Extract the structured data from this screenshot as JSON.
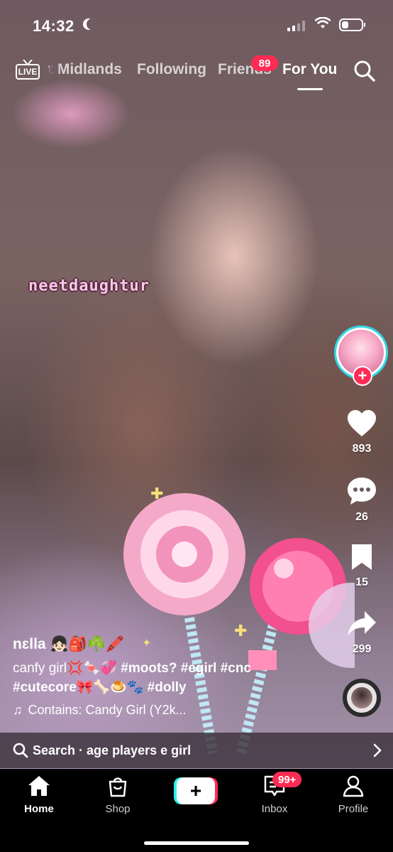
{
  "status_bar": {
    "time": "14:32",
    "battery_level": 0.35,
    "signal_bars_active": 2,
    "signal_bars_total": 4
  },
  "top_nav": {
    "live_label": "LIVE",
    "tabs": [
      {
        "label": "t Midlands"
      },
      {
        "label": "Following"
      },
      {
        "label": "Friends"
      },
      {
        "label": "For You"
      }
    ],
    "active_tab": "For You",
    "friends_badge": "89"
  },
  "video": {
    "overlay_text": "neetdaughtur"
  },
  "actions": {
    "likes": "893",
    "comments": "26",
    "saves": "15",
    "shares": "299"
  },
  "caption": {
    "username": "nɛlla",
    "username_emojis": "👧🏻🎒☘️🖍️",
    "line1_text": "canfy girl💢🍬💞",
    "line1_tags": "#moots? #egirl #cnc",
    "line2_tags": "#cutecore🎀🦴🍮🐾 #dolly",
    "music": "Contains: Candy Girl (Y2k..."
  },
  "search_suggestion": {
    "prefix": "Search",
    "separator": " · ",
    "query": "age players e girl"
  },
  "bottom_nav": {
    "items": [
      {
        "label": "Home"
      },
      {
        "label": "Shop"
      },
      {
        "label": ""
      },
      {
        "label": "Inbox"
      },
      {
        "label": "Profile"
      }
    ],
    "create_symbol": "+",
    "inbox_badge": "99+"
  },
  "colors": {
    "accent_red": "#fe2c55",
    "accent_cyan": "#25f4ee",
    "overlay_pink": "#f7c7e8"
  }
}
